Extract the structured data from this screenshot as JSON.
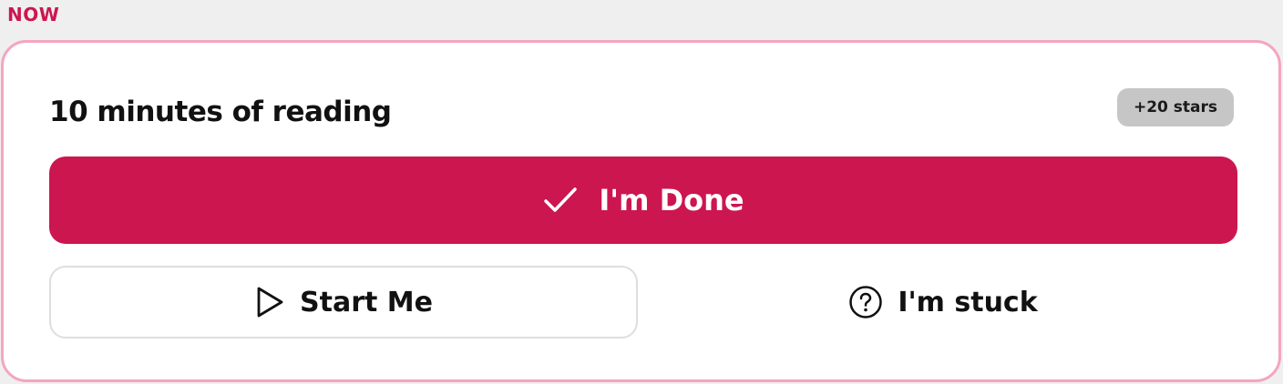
{
  "section": {
    "label": "NOW"
  },
  "task": {
    "title": "10 minutes of reading",
    "reward_label": "+20 stars"
  },
  "actions": {
    "done_label": "I'm Done",
    "start_label": "Start Me",
    "stuck_label": "I'm stuck"
  },
  "icons": {
    "done": "check-icon",
    "start": "play-icon",
    "stuck": "question-circle-icon"
  },
  "colors": {
    "accent": "#cc1650",
    "card_border": "#f4a5c0",
    "badge_bg": "#c6c6c6",
    "page_bg": "#efefef"
  }
}
